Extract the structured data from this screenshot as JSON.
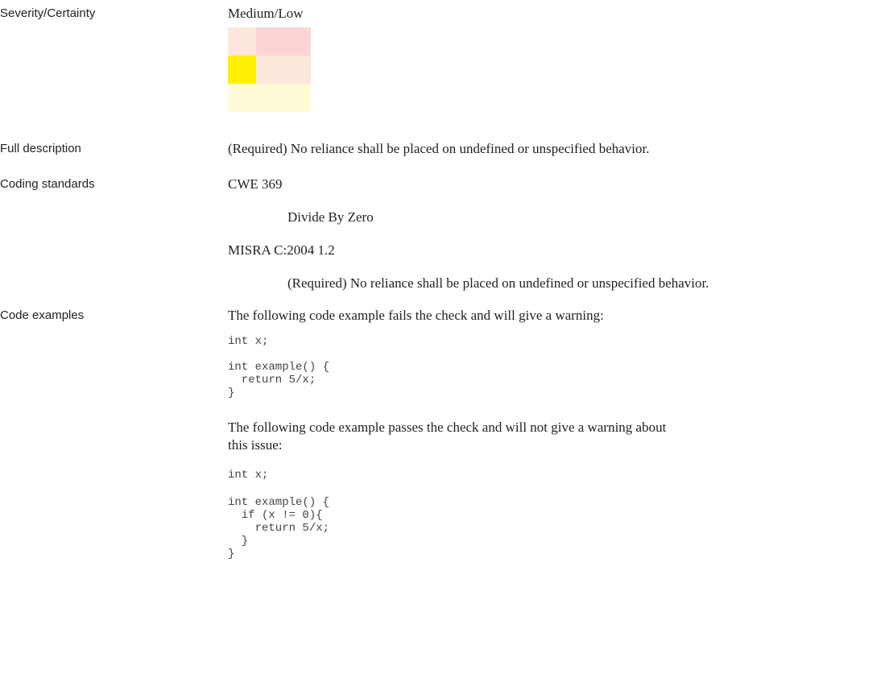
{
  "severity": {
    "label": "Severity/Certainty",
    "value": "Medium/Low",
    "matrix_colors": [
      [
        "#fde7da",
        "#fdd4d4",
        "#fdd4d4"
      ],
      [
        "#ffef00",
        "#fde7da",
        "#fde7da"
      ],
      [
        "#fffbd6",
        "#fffbd6",
        "#fffbd6"
      ]
    ]
  },
  "full_description": {
    "label": "Full description",
    "text": "(Required) No reliance shall be placed on undefined or unspecified behavior."
  },
  "coding_standards": {
    "label": "Coding standards",
    "items": [
      {
        "name": "CWE 369",
        "description": "Divide By Zero"
      },
      {
        "name": "MISRA C:2004 1.2",
        "description": "(Required) No reliance shall be placed on undefined or unspecified behavior."
      }
    ]
  },
  "code_examples": {
    "label": "Code examples",
    "fail_intro": "The following code example fails the check and will give a warning:",
    "fail_code_1": "int x;",
    "fail_code_2": "int example() {\n  return 5/x;\n}",
    "pass_intro": "The following code example passes the check and will not give a warning about this issue:",
    "pass_code_1": "int x;",
    "pass_code_2": "int example() {\n  if (x != 0){\n    return 5/x;\n  }\n}"
  }
}
